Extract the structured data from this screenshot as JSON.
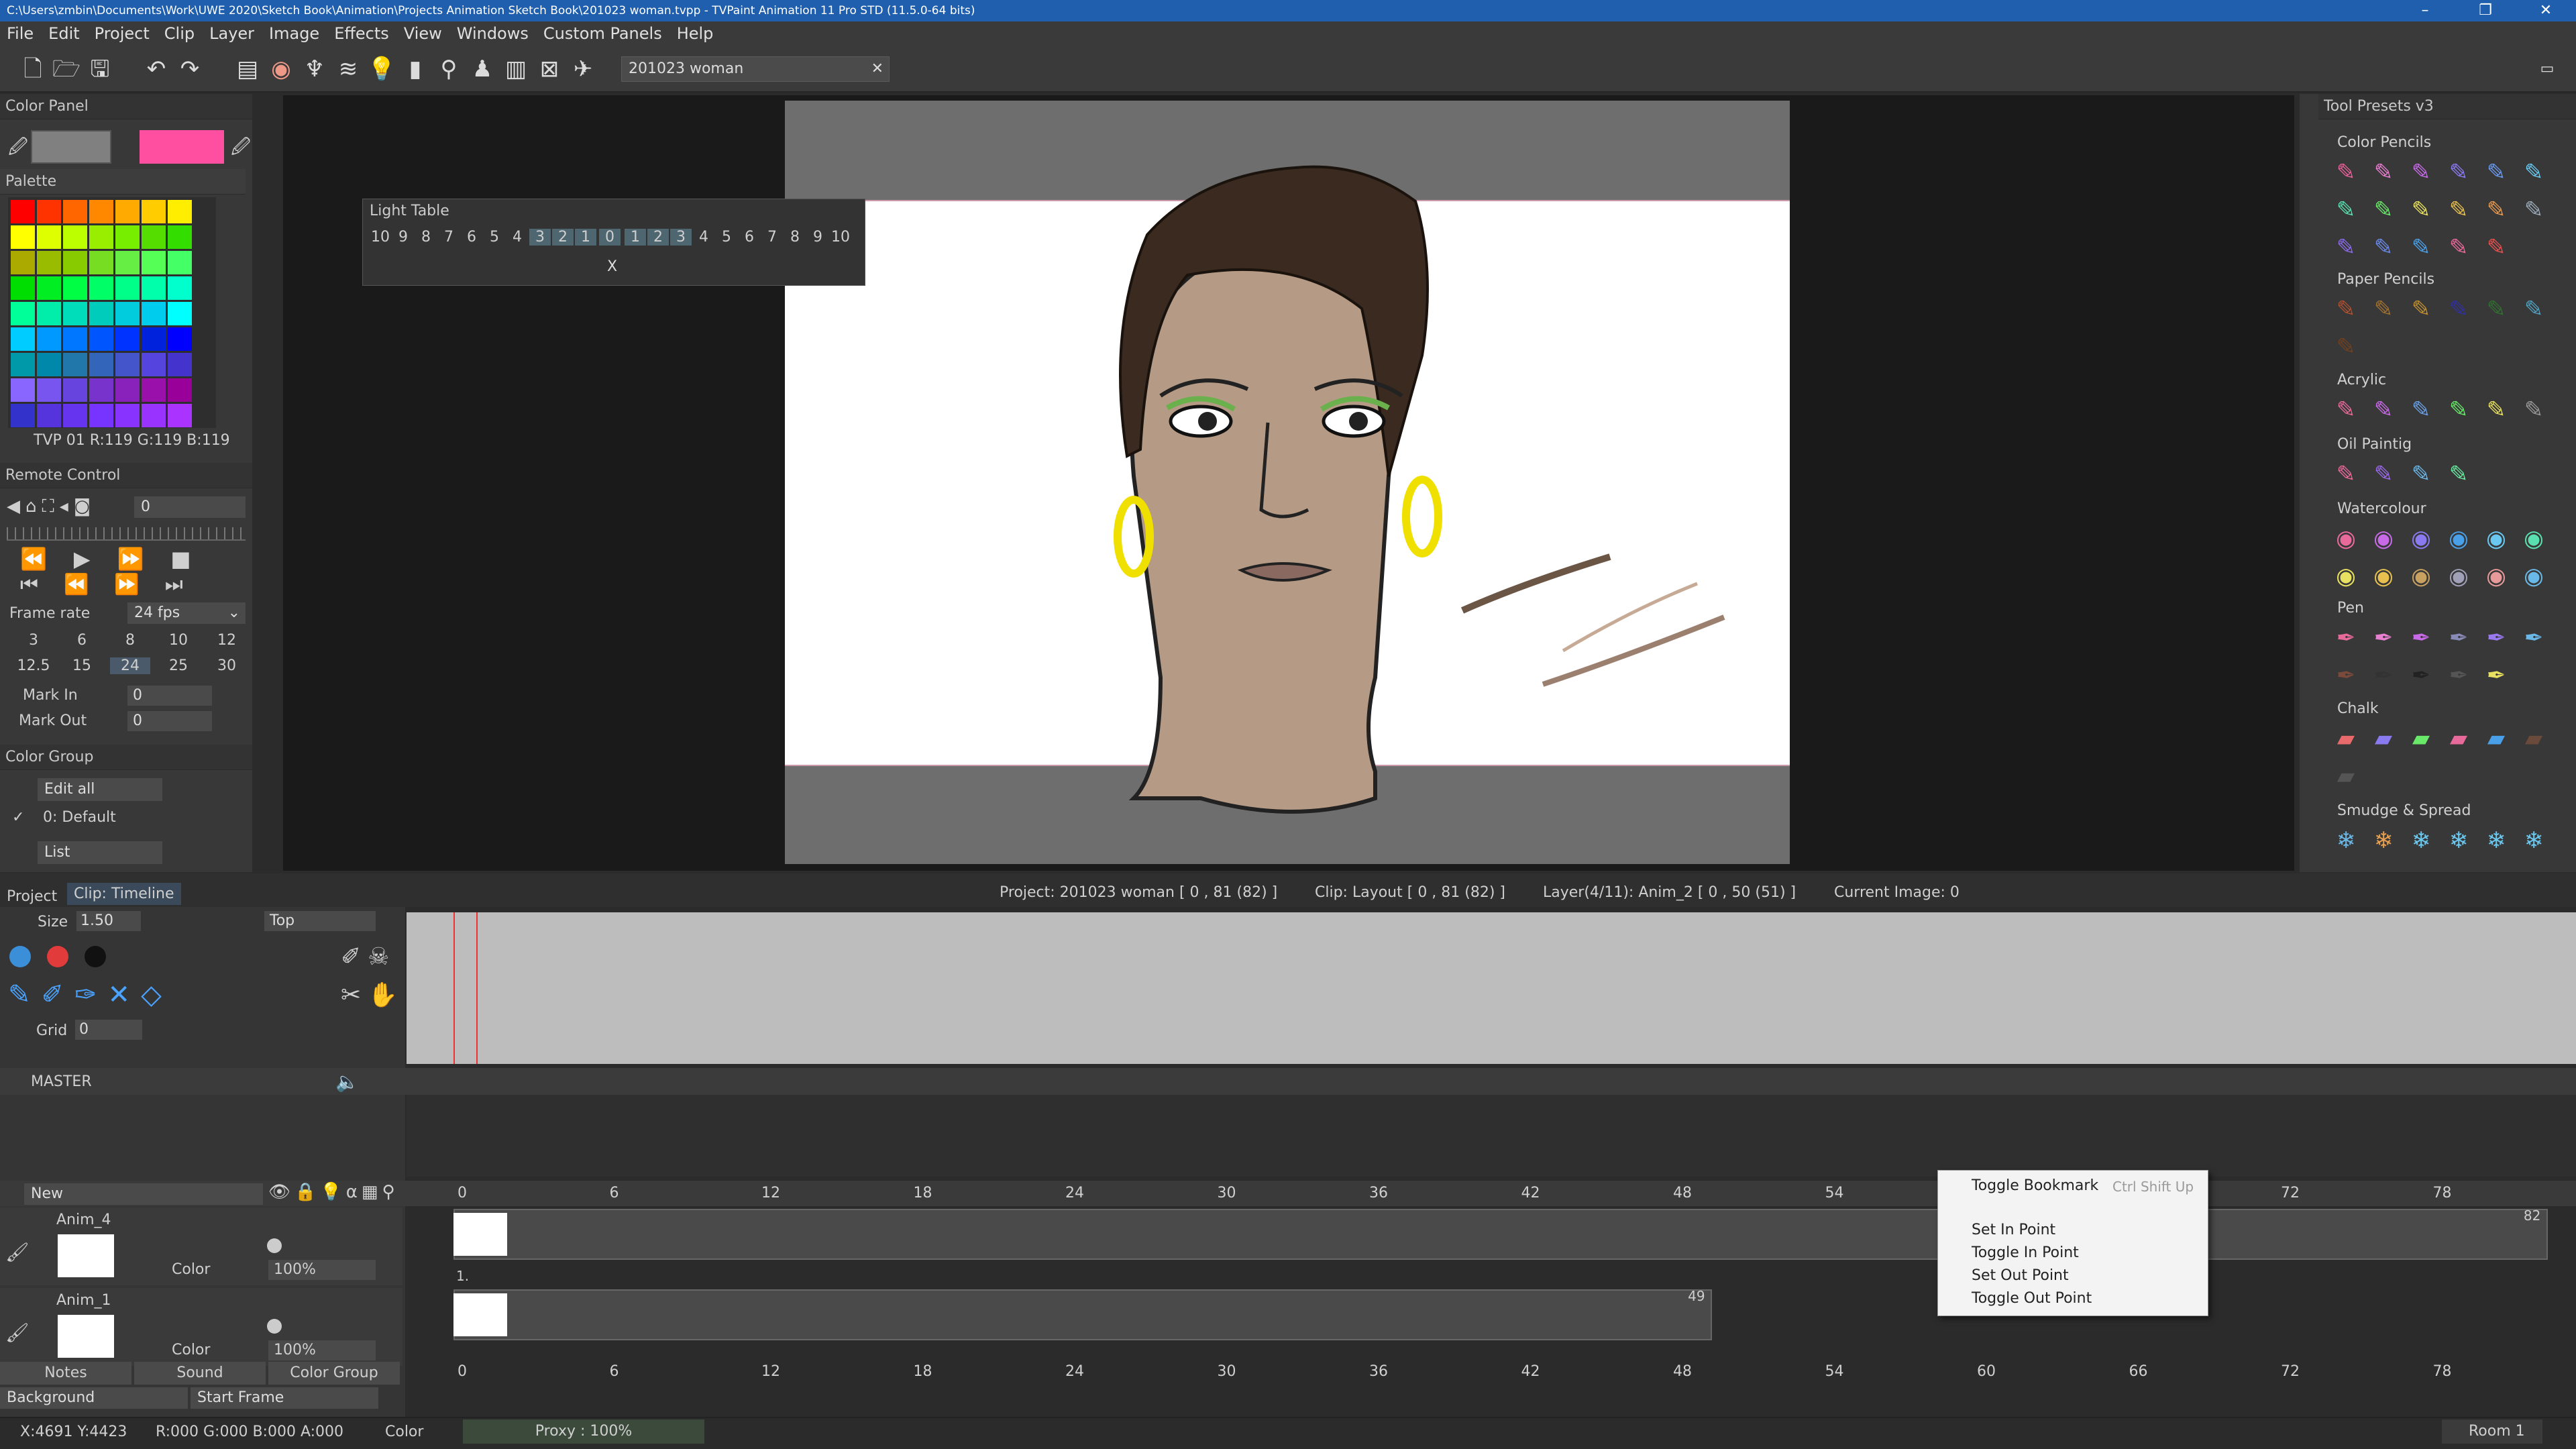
{
  "window": {
    "title": "C:\\Users\\zmbin\\Documents\\Work\\UWE 2020\\Sketch Book\\Animation\\Projects Animation Sketch Book\\201023 woman.tvpp - TVPaint Animation 11 Pro STD (11.5.0-64 bits)",
    "min": "–",
    "max": "❐",
    "close": "✕"
  },
  "menu": [
    "File",
    "Edit",
    "Project",
    "Clip",
    "Layer",
    "Image",
    "Effects",
    "View",
    "Windows",
    "Custom Panels",
    "Help"
  ],
  "toolbar": {
    "project_name": "201023 woman",
    "clear": "✕"
  },
  "color_panel": {
    "title": "Color Panel",
    "palette_title": "Palette",
    "color_info": "TVP 01 R:119 G:119 B:119",
    "primary": "#808080",
    "secondary": "#ff4fa0",
    "palette_colors": [
      [
        "#ff0000",
        "#ff3300",
        "#ff6600",
        "#ff8800",
        "#ffaa00",
        "#ffcc00",
        "#ffee00"
      ],
      [
        "#ffff00",
        "#ddff00",
        "#bbff00",
        "#99ee00",
        "#77ee00",
        "#55dd00",
        "#33dd00"
      ],
      [
        "#aaaa00",
        "#99bb00",
        "#88cc00",
        "#77dd22",
        "#66ee44",
        "#55ff55",
        "#44ff66"
      ],
      [
        "#00dd00",
        "#00ee22",
        "#00ff44",
        "#00ff66",
        "#00ff88",
        "#00ffaa",
        "#00ffcc"
      ],
      [
        "#00ff99",
        "#00eeaa",
        "#00ddbb",
        "#00ccbb",
        "#00ccdd",
        "#00ccee",
        "#00ffff"
      ],
      [
        "#00ccff",
        "#0099ff",
        "#0077ff",
        "#0055ff",
        "#0033ff",
        "#0022dd",
        "#0000ff"
      ],
      [
        "#0099aa",
        "#0088aa",
        "#2277aa",
        "#3366bb",
        "#4455cc",
        "#5544dd",
        "#4433cc"
      ],
      [
        "#8866ff",
        "#7755ee",
        "#6644dd",
        "#7733cc",
        "#8822bb",
        "#9911aa",
        "#990099"
      ],
      [
        "#3333cc",
        "#5533dd",
        "#6633ee",
        "#7733ff",
        "#8833ff",
        "#9933ff",
        "#aa33ff"
      ]
    ]
  },
  "remote": {
    "title": "Remote Control",
    "frame_value": "0",
    "frame_rate_label": "Frame rate",
    "fps": "24 fps",
    "rates_row1": [
      "3",
      "6",
      "8",
      "10",
      "12"
    ],
    "rates_row2": [
      "12.5",
      "15",
      "24",
      "25",
      "30"
    ],
    "mark_in_label": "Mark In",
    "mark_in": "0",
    "mark_out_label": "Mark Out",
    "mark_out": "0"
  },
  "color_group": {
    "title": "Color Group",
    "edit_all": "Edit all",
    "default": "0: Default",
    "list": "List"
  },
  "light_table": {
    "title": "Light Table",
    "left": [
      "10",
      "9",
      "8",
      "7",
      "6",
      "5",
      "4",
      "3",
      "2",
      "1"
    ],
    "center": "0",
    "right": [
      "1",
      "2",
      "3",
      "4",
      "5",
      "6",
      "7",
      "8",
      "9",
      "10"
    ],
    "x": "X"
  },
  "presets": {
    "title": "Tool Presets v3",
    "sections": [
      "Color Pencils",
      "Paper Pencils",
      "Acrylic",
      "Oil Paintig",
      "Watercolour",
      "Pen",
      "Chalk",
      "Smudge & Spread"
    ]
  },
  "timeline": {
    "tab_project": "Project",
    "tab_clip": "Clip: Timeline",
    "project_info": "Project: 201023 woman [ 0 , 81  (82) ]",
    "clip_info": "Clip: Layout [ 0 , 81  (82) ]",
    "layer_info": "Layer(4/11): Anim_2 [ 0 , 50  (51) ]",
    "current_image": "Current Image: 0",
    "size_label": "Size",
    "size": "1.50",
    "top_label": "Top",
    "grid_label": "Grid",
    "grid": "0",
    "master": "MASTER",
    "new_label": "New",
    "layers": [
      {
        "name": "Anim_4",
        "blend": "Color",
        "opacity": "100%",
        "end": "82"
      },
      {
        "name": "Anim_1",
        "blend": "Color",
        "opacity": "100%",
        "end": "49"
      }
    ],
    "ruler": [
      "0",
      "6",
      "12",
      "18",
      "24",
      "30",
      "36",
      "42",
      "48",
      "54",
      "60",
      "66",
      "72",
      "78"
    ],
    "ruler_top": [
      "0",
      "6",
      "12",
      "18",
      "24",
      "30",
      "36",
      "42",
      "48",
      "54",
      "72",
      "78"
    ],
    "bottom_tabs": [
      "Notes",
      "Sound",
      "Color Group"
    ],
    "background": "Background",
    "start_frame": "Start Frame",
    "frame_one": "1."
  },
  "context_menu": {
    "items": [
      "Toggle Bookmark",
      "Set In Point",
      "Toggle In Point",
      "Set Out Point",
      "Toggle Out Point"
    ],
    "shortcut": "Ctrl Shift Up"
  },
  "status": {
    "coords": "X:4691  Y:4423",
    "rgba": "R:000 G:000 B:000 A:000",
    "mode": "Color",
    "proxy": "Proxy : 100%",
    "room": "Room 1"
  }
}
